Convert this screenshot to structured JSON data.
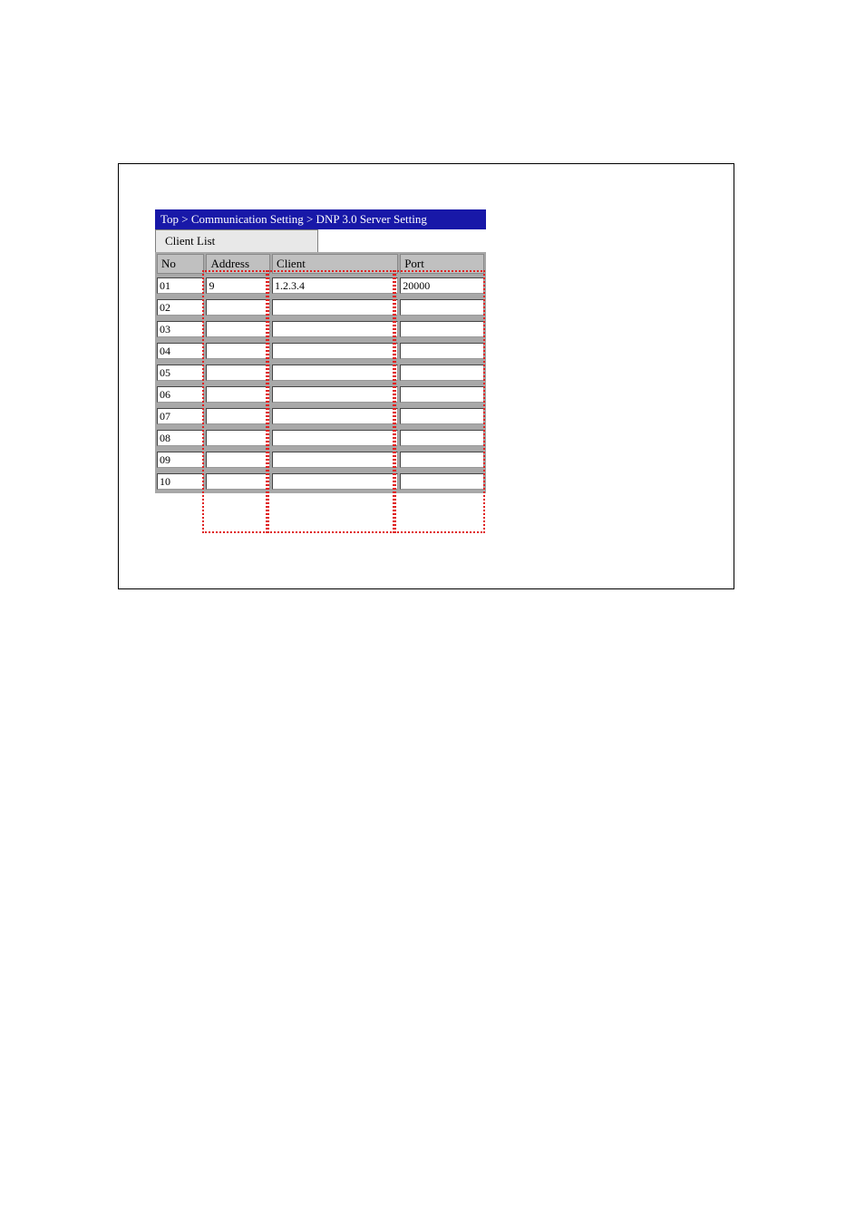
{
  "breadcrumb": "Top > Communication Setting > DNP 3.0 Server Setting",
  "tab": {
    "label": "Client List"
  },
  "table": {
    "headers": {
      "no": "No",
      "address": "Address",
      "client": "Client",
      "port": "Port"
    },
    "rows": [
      {
        "no": "01",
        "address": "9",
        "client": "1.2.3.4",
        "port": "20000"
      },
      {
        "no": "02",
        "address": "",
        "client": "",
        "port": ""
      },
      {
        "no": "03",
        "address": "",
        "client": "",
        "port": ""
      },
      {
        "no": "04",
        "address": "",
        "client": "",
        "port": ""
      },
      {
        "no": "05",
        "address": "",
        "client": "",
        "port": ""
      },
      {
        "no": "06",
        "address": "",
        "client": "",
        "port": ""
      },
      {
        "no": "07",
        "address": "",
        "client": "",
        "port": ""
      },
      {
        "no": "08",
        "address": "",
        "client": "",
        "port": ""
      },
      {
        "no": "09",
        "address": "",
        "client": "",
        "port": ""
      },
      {
        "no": "10",
        "address": "",
        "client": "",
        "port": ""
      }
    ]
  }
}
